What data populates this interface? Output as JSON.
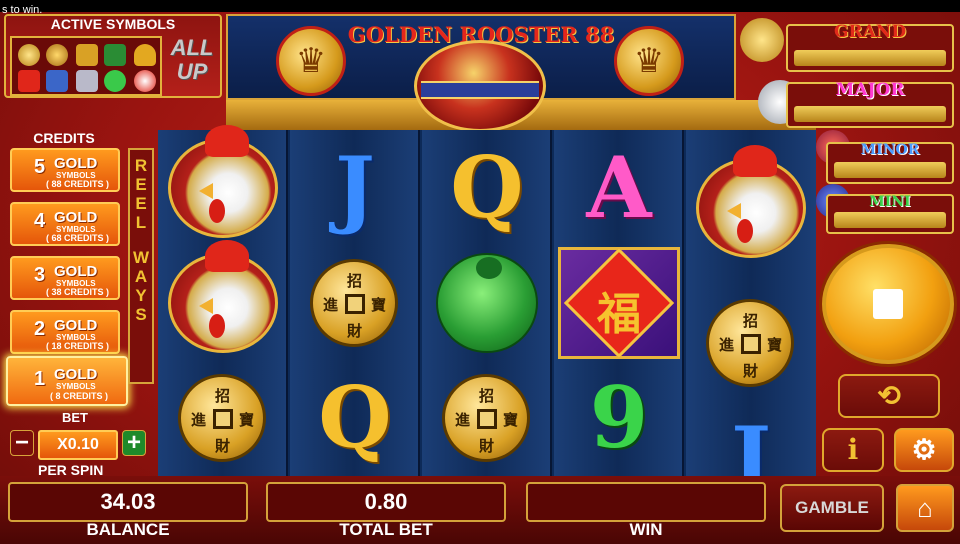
{
  "top_notice": "s to win.",
  "active_symbols": {
    "title": "ACTIVE SYMBOLS",
    "icons": [
      "coin-icon",
      "token-icon",
      "lantern-icon",
      "fan-icon",
      "lucky-bag-icon",
      "envelope-icon",
      "fish-icon",
      "dragon-icon",
      "jade-icon",
      "rooster-icon"
    ],
    "all_up_line1": "ALL",
    "all_up_line2": "UP"
  },
  "title": "GOLDEN ROOSTER 88",
  "jackpots": [
    {
      "label": "GRAND",
      "color": "#e02a1a"
    },
    {
      "label": "MAJOR",
      "color": "#ff3ad0"
    },
    {
      "label": "MINOR",
      "color": "#4a9cff"
    },
    {
      "label": "MINI",
      "color": "#3ad44a"
    }
  ],
  "credits": {
    "title": "CREDITS",
    "options": [
      {
        "num": "5",
        "gold": "GOLD",
        "symbols": "SYMBOLS",
        "credits": "( 88 CREDITS )"
      },
      {
        "num": "4",
        "gold": "GOLD",
        "symbols": "SYMBOLS",
        "credits": "( 68 CREDITS )"
      },
      {
        "num": "3",
        "gold": "GOLD",
        "symbols": "SYMBOLS",
        "credits": "( 38 CREDITS )"
      },
      {
        "num": "2",
        "gold": "GOLD",
        "symbols": "SYMBOLS",
        "credits": "( 18 CREDITS )"
      },
      {
        "num": "1",
        "gold": "GOLD",
        "symbols": "SYMBOLS",
        "credits": "( 8 CREDITS )"
      }
    ],
    "selected": "1"
  },
  "reel_ways": [
    "R",
    "E",
    "E",
    "L",
    "W",
    "A",
    "Y",
    "S"
  ],
  "bet": {
    "label": "BET",
    "minus": "−",
    "value": "X0.10",
    "plus": "+",
    "per_spin_label": "PER SPIN"
  },
  "reels": {
    "col1": [
      "rooster",
      "rooster",
      "coin"
    ],
    "col2": [
      "J",
      "coin",
      "Q"
    ],
    "col3": [
      "Q",
      "jade",
      "coin"
    ],
    "col4": [
      "A",
      "fu",
      "9"
    ],
    "col5": [
      "rooster",
      "coin",
      "J"
    ]
  },
  "coin_chars": {
    "top": "招",
    "left": "進",
    "right": "寶",
    "bottom": "財"
  },
  "fu_char": "福",
  "bottom": {
    "balance_value": "34.03",
    "balance_label": "BALANCE",
    "total_bet_value": "0.80",
    "total_bet_label": "TOTAL BET",
    "win_value": "",
    "win_label": "WIN"
  },
  "controls": {
    "spin_icon": "stop-icon",
    "autoplay_icon": "repeat-icon",
    "info_label": "i",
    "settings_icon": "gear-icon",
    "gamble_label": "GAMBLE",
    "home_icon": "home-icon"
  },
  "colors": {
    "accent_gold": "#e8b63c",
    "panel_red": "#7a0e0a",
    "reel_blue": "#0f2a57"
  }
}
